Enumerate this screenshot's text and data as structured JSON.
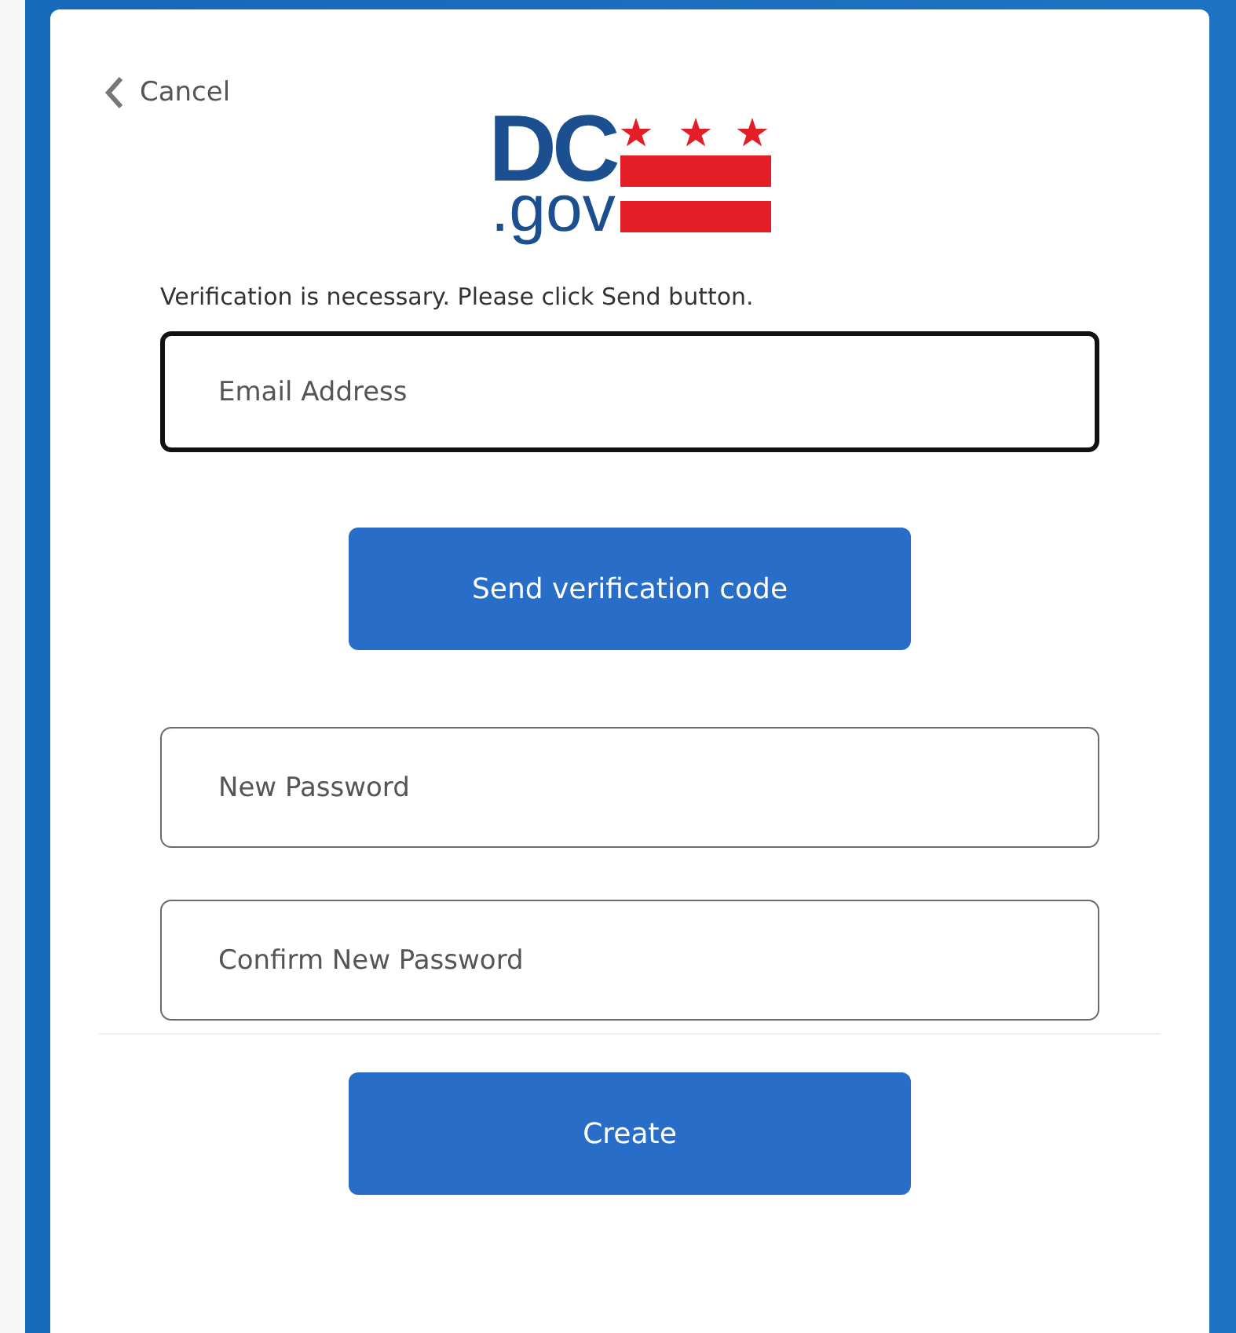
{
  "cancel_link": {
    "label": "Cancel"
  },
  "logo": {
    "top": "DC",
    "bottom": ".gov"
  },
  "message": "Verification is necessary. Please click Send button.",
  "email_field": {
    "placeholder": "Email Address",
    "focused": true
  },
  "send_button": {
    "label": "Send verification code"
  },
  "password_fields": [
    {
      "placeholder": "New Password",
      "focused": false
    },
    {
      "placeholder": "Confirm New Password",
      "focused": false
    }
  ],
  "create_button": {
    "label": "Create"
  }
}
